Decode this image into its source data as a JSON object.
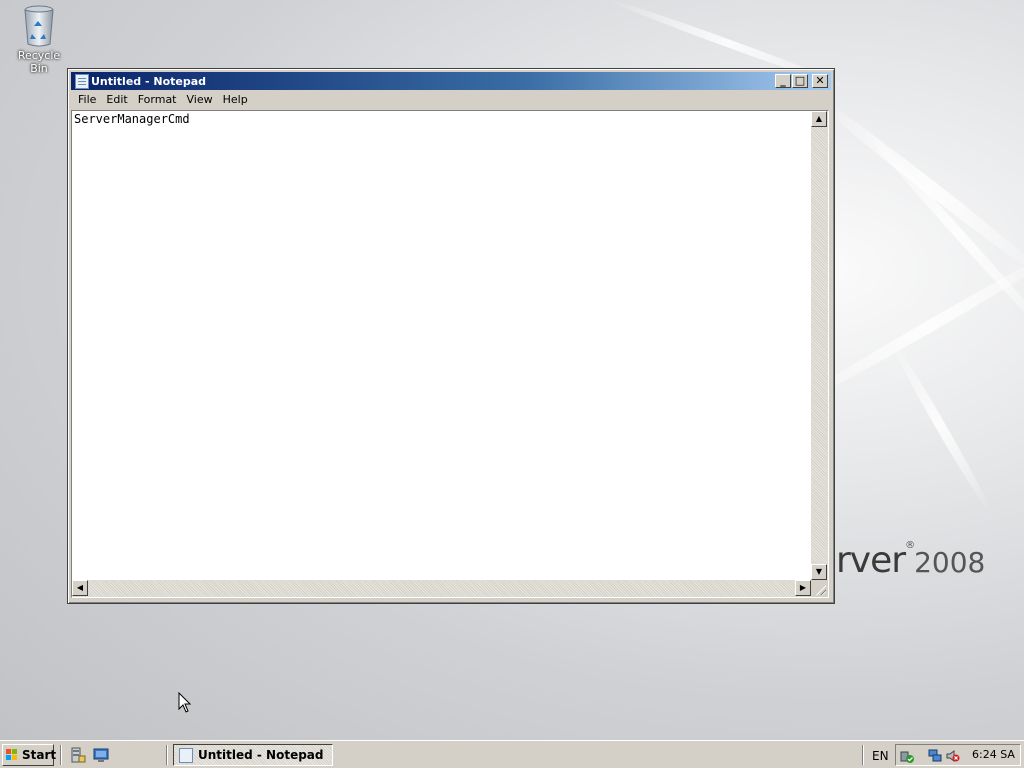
{
  "desktop": {
    "recycle_bin_label": "Recycle Bin",
    "wallpaper_brand_text": "rver",
    "wallpaper_brand_year": "2008"
  },
  "notepad": {
    "title": "Untitled - Notepad",
    "menu": [
      "File",
      "Edit",
      "Format",
      "View",
      "Help"
    ],
    "content": "ServerManagerCmd",
    "title_buttons": {
      "minimize": "_",
      "maximize": "□",
      "close": "✕"
    }
  },
  "taskbar": {
    "start_label": "Start",
    "task_button_label": "Untitled - Notepad",
    "language": "EN",
    "clock": "6:24 SA"
  },
  "colors": {
    "titlebar_start": "#0a246a",
    "titlebar_end": "#a6caf0",
    "chrome": "#d4d0c8"
  },
  "icons": {
    "desktop": "recycle-bin-icon",
    "quick_launch": [
      "server-manager-icon",
      "show-desktop-icon"
    ],
    "tray": [
      "security-shield-icon",
      "network-icon",
      "volume-muted-icon"
    ]
  }
}
